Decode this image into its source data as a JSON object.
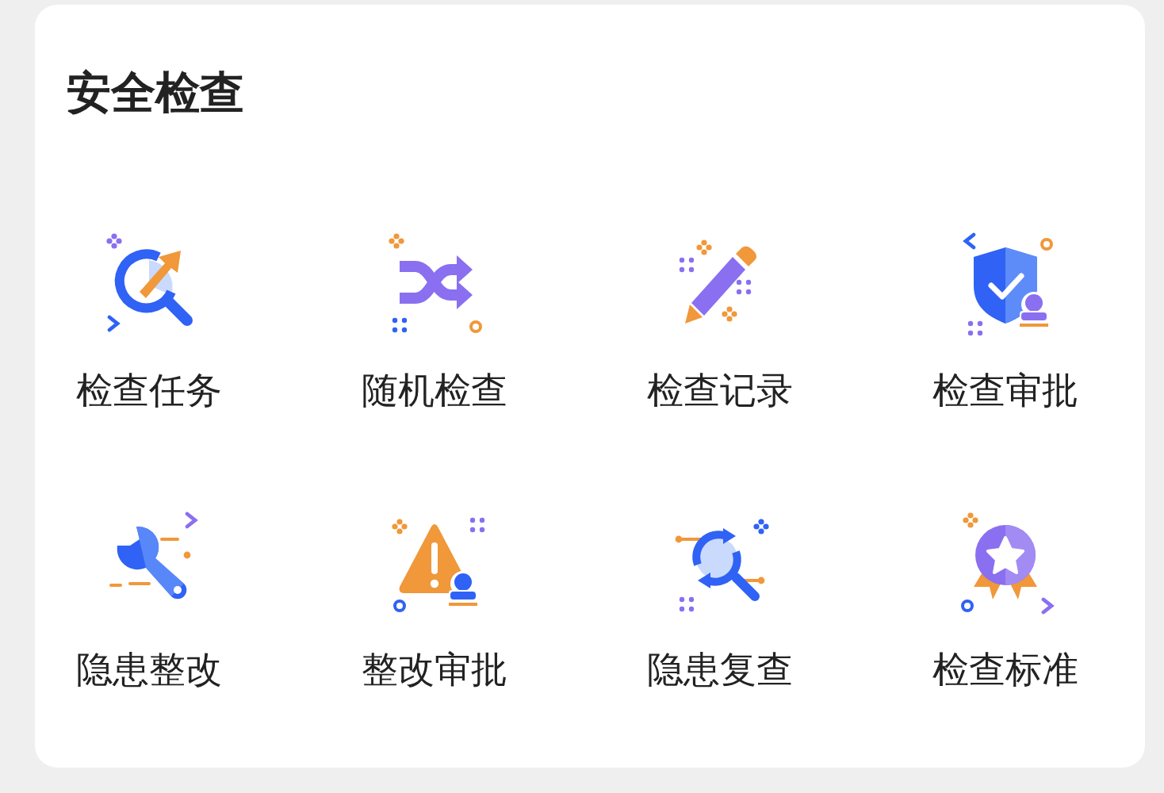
{
  "card": {
    "title": "安全检查",
    "items": [
      {
        "label": "检查任务"
      },
      {
        "label": "随机检查"
      },
      {
        "label": "检查记录"
      },
      {
        "label": "检查审批"
      },
      {
        "label": "隐患整改"
      },
      {
        "label": "整改审批"
      },
      {
        "label": "隐患复查"
      },
      {
        "label": "检查标准"
      }
    ]
  }
}
